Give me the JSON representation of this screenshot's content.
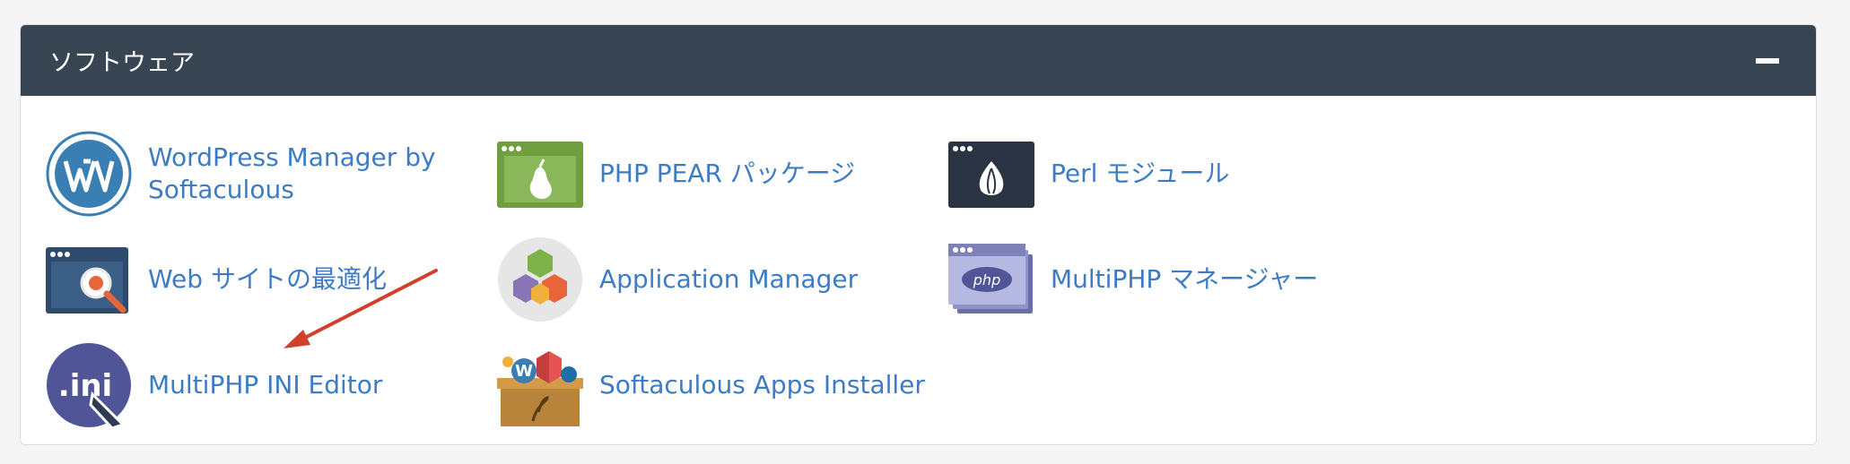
{
  "panel": {
    "title": "ソフトウェア",
    "collapse_icon": "minus-icon"
  },
  "items": [
    {
      "label": "WordPress Manager by Softaculous",
      "label_line1": "WordPress Manager by",
      "label_line2": "Softaculous",
      "icon": "wordpress-icon"
    },
    {
      "label": "PHP PEAR パッケージ",
      "icon": "php-pear-icon"
    },
    {
      "label": "Perl モジュール",
      "icon": "perl-module-icon"
    },
    {
      "label": "Web サイトの最適化",
      "icon": "website-optimize-icon"
    },
    {
      "label": "Application Manager",
      "icon": "application-manager-icon"
    },
    {
      "label": "MultiPHP マネージャー",
      "icon": "multiphp-manager-icon",
      "icon_text": "php"
    },
    {
      "label": "MultiPHP INI Editor",
      "icon": "multiphp-ini-icon",
      "icon_text": ".ini"
    },
    {
      "label": "Softaculous Apps Installer",
      "icon": "softaculous-icon"
    }
  ],
  "colors": {
    "header_bg": "#384553",
    "link": "#3d7cc4",
    "arrow": "#d0402b"
  }
}
